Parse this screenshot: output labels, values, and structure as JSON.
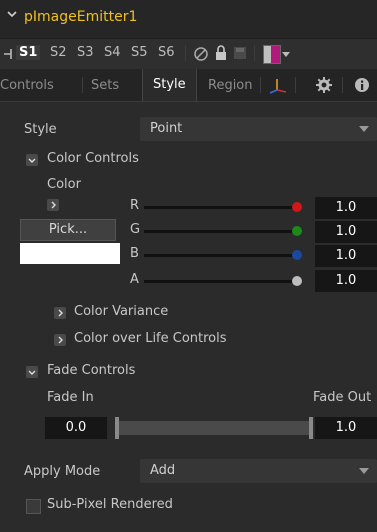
{
  "header": {
    "title": "pImageEmitter1"
  },
  "slots": {
    "items": [
      "S1",
      "S2",
      "S3",
      "S4",
      "S5",
      "S6"
    ],
    "active": "S1"
  },
  "tabs": {
    "items": [
      "Controls",
      "Sets",
      "Style",
      "Region"
    ],
    "active": "Style"
  },
  "style": {
    "label": "Style",
    "value": "Point"
  },
  "color_controls": {
    "header": "Color Controls",
    "color_label": "Color",
    "pick_label": "Pick...",
    "swatch_color": "#ffffff",
    "channels": [
      {
        "label": "R",
        "value": "1.0",
        "dot_color": "#d01818"
      },
      {
        "label": "G",
        "value": "1.0",
        "dot_color": "#1a8a1a"
      },
      {
        "label": "B",
        "value": "1.0",
        "dot_color": "#1a4aa0"
      },
      {
        "label": "A",
        "value": "1.0",
        "dot_color": "#bdbdbd"
      }
    ],
    "variance": "Color Variance",
    "over_life": "Color over Life Controls"
  },
  "fade_controls": {
    "header": "Fade Controls",
    "fade_in_label": "Fade In",
    "fade_out_label": "Fade Out",
    "fade_in_value": "0.0",
    "fade_out_value": "1.0"
  },
  "apply_mode": {
    "label": "Apply Mode",
    "value": "Add"
  },
  "sub_pixel": {
    "label": "Sub-Pixel Rendered",
    "checked": false
  },
  "colors": {
    "title": "#f0c020",
    "background": "#2b2b2b"
  }
}
